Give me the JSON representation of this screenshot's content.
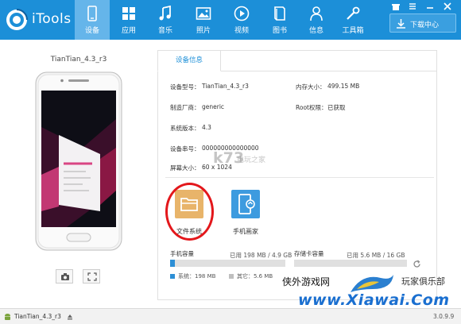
{
  "app": {
    "brand": "iTools",
    "colors": {
      "topbar": "#1c8fd8",
      "active_tab": "#65b5ea",
      "accent": "#2d8fd6",
      "highlight_circle": "#e3171b"
    }
  },
  "nav": [
    {
      "label": "设备",
      "icon": "device-icon",
      "active": true
    },
    {
      "label": "应用",
      "icon": "apps-icon"
    },
    {
      "label": "音乐",
      "icon": "music-icon"
    },
    {
      "label": "照片",
      "icon": "photo-icon"
    },
    {
      "label": "视频",
      "icon": "video-icon"
    },
    {
      "label": "图书",
      "icon": "book-icon"
    },
    {
      "label": "信息",
      "icon": "user-icon"
    },
    {
      "label": "工具箱",
      "icon": "toolbox-icon"
    }
  ],
  "download_center": {
    "label": "下载中心",
    "icon": "download-icon"
  },
  "device": {
    "name": "TianTian_4.3_r3"
  },
  "info_tab": {
    "label": "设备信息"
  },
  "info": {
    "model_key": "设备型号：",
    "model_val": "TianTian_4.3_r3",
    "memory_key": "内存大小：",
    "memory_val": "499.15 MB",
    "maker_key": "制造厂商：",
    "maker_val": "generic",
    "root_key": "Root权限：",
    "root_val": "已获取",
    "version_key": "系统版本：",
    "version_val": "4.3",
    "serial_key": "设备串号：",
    "serial_val": "000000000000000",
    "resolution_key": "屏幕大小：",
    "resolution_val": "60 x 1024"
  },
  "tools": [
    {
      "label": "文件系统",
      "icon": "folder-icon"
    },
    {
      "label": "手机画家",
      "icon": "phone-painter-icon"
    }
  ],
  "storage": {
    "phone": {
      "title": "手机容量",
      "used_text": "已用 198 MB / 4.9 GB",
      "fill_fraction": 0.04
    },
    "sd": {
      "title": "存储卡容量",
      "used_text": "已用 5.6 MB / 16 GB",
      "fill_fraction": 0.0
    },
    "legend_system": "系统：198 MB",
    "legend_other": "其它：5.6 MB"
  },
  "statusbar": {
    "device": "TianTian_4.3_r3",
    "version": "3.0.9.9"
  },
  "watermarks": {
    "k73": "k73",
    "k73_cn": "电玩之家",
    "xiawai_cn": "侠外游戏网",
    "xiawai_club": "玩家俱乐部",
    "xiawai_url": "www.Xiawai.Com"
  }
}
